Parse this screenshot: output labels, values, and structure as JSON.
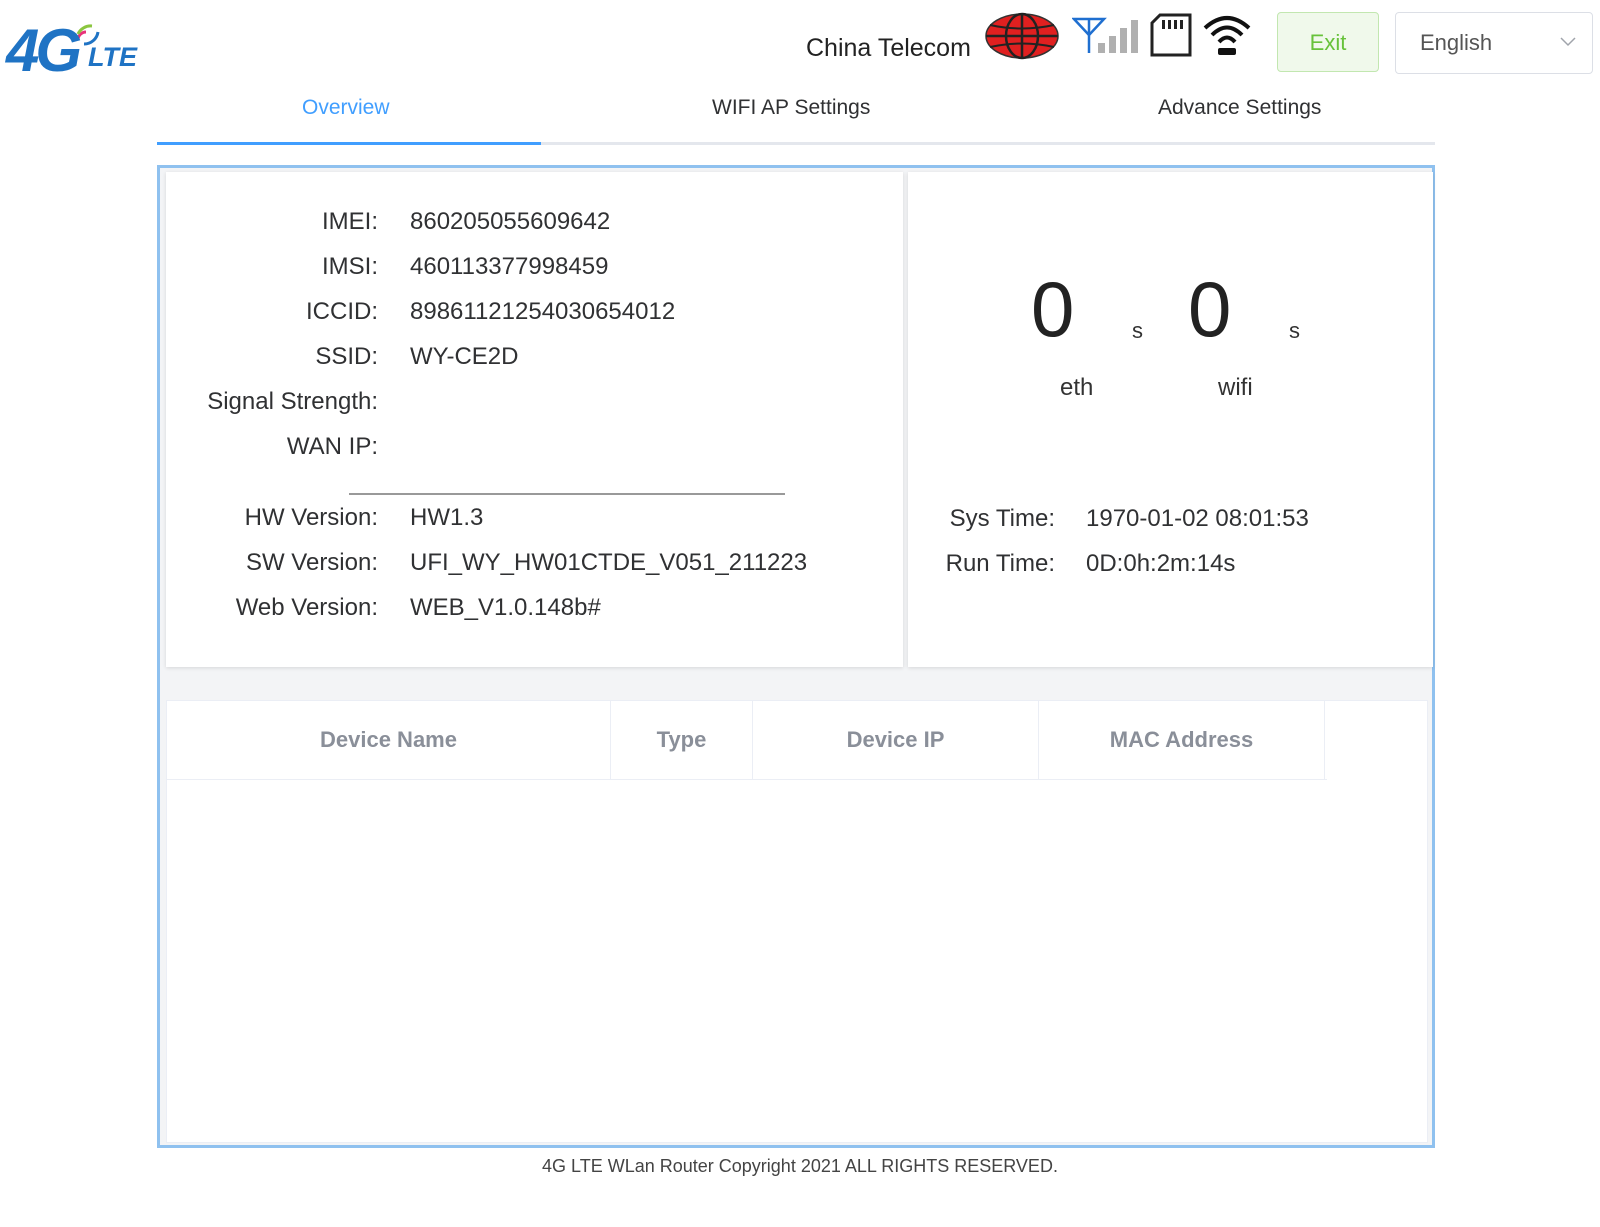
{
  "logo": {
    "big": "4G",
    "small": "LTE"
  },
  "header": {
    "carrier": "China Telecom",
    "exit_label": "Exit",
    "language": "English"
  },
  "tabs": [
    {
      "label": "Overview",
      "active": true
    },
    {
      "label": "WIFI AP Settings",
      "active": false
    },
    {
      "label": "Advance Settings",
      "active": false
    }
  ],
  "info": {
    "imei_label": "IMEI:",
    "imei": "860205055609642",
    "imsi_label": "IMSI:",
    "imsi": "460113377998459",
    "iccid_label": "ICCID:",
    "iccid": "89861121254030654012",
    "ssid_label": "SSID:",
    "ssid": "WY-CE2D",
    "signal_label": "Signal Strength:",
    "signal": "",
    "wanip_label": "WAN IP:",
    "wanip": "",
    "hw_label": "HW Version:",
    "hw": "HW1.3",
    "sw_label": "SW Version:",
    "sw": "UFI_WY_HW01CTDE_V051_211223",
    "web_label": "Web Version:",
    "web": "WEB_V1.0.148b#"
  },
  "stats": {
    "eth_count": "0",
    "eth_unit": "s",
    "eth_label": "eth",
    "wifi_count": "0",
    "wifi_unit": "s",
    "wifi_label": "wifi",
    "systime_label": "Sys Time:",
    "systime": "1970-01-02 08:01:53",
    "runtime_label": "Run Time:",
    "runtime": "0D:0h:2m:14s"
  },
  "table": {
    "columns": [
      "Device Name",
      "Type",
      "Device IP",
      "MAC Address"
    ],
    "rows": []
  },
  "footer": "4G LTE WLan Router Copyright 2021 ALL RIGHTS RESERVED.",
  "colors": {
    "accent": "#409eff",
    "exit_green": "#67c23a",
    "frame_border": "#8fc1ef",
    "globe_red": "#e02020",
    "logo_blue": "#1f73c4"
  },
  "icons": [
    "globe-icon",
    "signal-antenna-icon",
    "sim-card-icon",
    "wifi-icon",
    "chevron-down-icon"
  ]
}
